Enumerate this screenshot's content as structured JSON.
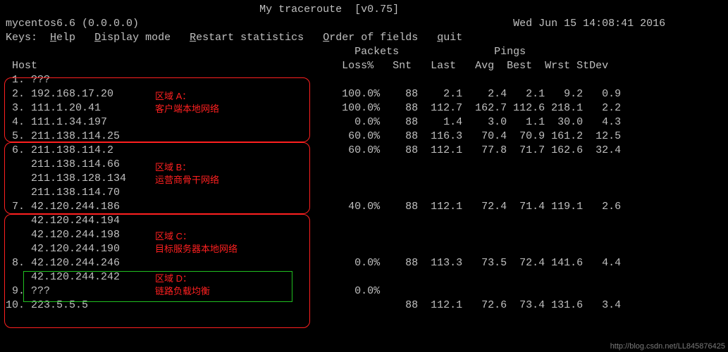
{
  "chart_data": {
    "type": "table",
    "columns": [
      "Hop",
      "Host",
      "Loss%",
      "Snt",
      "Last",
      "Avg",
      "Best",
      "Wrst",
      "StDev"
    ],
    "rows": [
      {
        "Hop": 1,
        "Host": "???",
        "Loss%": null,
        "Snt": null,
        "Last": null,
        "Avg": null,
        "Best": null,
        "Wrst": null,
        "StDev": null
      },
      {
        "Hop": 2,
        "Host": "192.168.17.20",
        "Loss%": 100.0,
        "Snt": 88,
        "Last": 2.1,
        "Avg": 2.4,
        "Best": 2.1,
        "Wrst": 9.2,
        "StDev": 0.9
      },
      {
        "Hop": 3,
        "Host": "111.1.20.41",
        "Loss%": 100.0,
        "Snt": 88,
        "Last": 112.7,
        "Avg": 162.7,
        "Best": 112.6,
        "Wrst": 218.1,
        "StDev": 2.2
      },
      {
        "Hop": 4,
        "Host": "111.1.34.197",
        "Loss%": 0.0,
        "Snt": 88,
        "Last": 1.4,
        "Avg": 3.0,
        "Best": 1.1,
        "Wrst": 30.0,
        "StDev": 4.3
      },
      {
        "Hop": 5,
        "Host": "211.138.114.25",
        "Loss%": 60.0,
        "Snt": 88,
        "Last": 116.3,
        "Avg": 70.4,
        "Best": 70.9,
        "Wrst": 161.2,
        "StDev": 12.5
      },
      {
        "Hop": 6,
        "Host": "211.138.114.2",
        "Loss%": 60.0,
        "Snt": 88,
        "Last": 112.1,
        "Avg": 77.8,
        "Best": 71.7,
        "Wrst": 162.6,
        "StDev": 32.4
      },
      {
        "Hop": 6,
        "Host": "211.138.114.66"
      },
      {
        "Hop": 6,
        "Host": "211.138.128.134"
      },
      {
        "Hop": 6,
        "Host": "211.138.114.70"
      },
      {
        "Hop": 7,
        "Host": "42.120.244.186",
        "Loss%": 40.0,
        "Snt": 88,
        "Last": 112.1,
        "Avg": 72.4,
        "Best": 71.4,
        "Wrst": 119.1,
        "StDev": 2.6
      },
      {
        "Hop": 7,
        "Host": "42.120.244.194"
      },
      {
        "Hop": 7,
        "Host": "42.120.244.198"
      },
      {
        "Hop": 7,
        "Host": "42.120.244.190"
      },
      {
        "Hop": 8,
        "Host": "42.120.244.246",
        "Loss%": 0.0,
        "Snt": 88,
        "Last": 113.3,
        "Avg": 73.5,
        "Best": 72.4,
        "Wrst": 141.6,
        "StDev": 4.4
      },
      {
        "Hop": 8,
        "Host": "42.120.244.242"
      },
      {
        "Hop": 9,
        "Host": "???",
        "Loss%": 0.0
      },
      {
        "Hop": 10,
        "Host": "223.5.5.5",
        "Snt": 88,
        "Last": 112.1,
        "Avg": 72.6,
        "Best": 73.4,
        "Wrst": 131.6,
        "StDev": 3.4
      }
    ]
  },
  "header": {
    "title": "My traceroute  [v0.75]",
    "hostline": "mycentos6.6 (0.0.0.0)",
    "date": "Wed Jun 15 14:08:41 2016"
  },
  "menu": {
    "keys": "Keys:",
    "help": {
      "u": "H",
      "rest": "elp"
    },
    "display": {
      "u": "D",
      "rest": "isplay mode"
    },
    "restart": {
      "u": "R",
      "rest": "estart statistics"
    },
    "order": {
      "u": "O",
      "rest": "rder of fields"
    },
    "quit": {
      "u": "q",
      "rest": "uit"
    }
  },
  "headers": {
    "packets": "Packets",
    "pings": "Pings",
    "host": "Host",
    "cols": "Loss%   Snt   Last   Avg  Best  Wrst StDev"
  },
  "rows": {
    "r1": " 1. ???",
    "r2": " 2. 192.168.17.20                                    100.0%    88    2.1    2.4   2.1   9.2   0.9",
    "r3": " 3. 111.1.20.41                                      100.0%    88  112.7  162.7 112.6 218.1   2.2",
    "r4": " 4. 111.1.34.197                                       0.0%    88    1.4    3.0   1.1  30.0   4.3",
    "r5": " 5. 211.138.114.25                                    60.0%    88  116.3   70.4  70.9 161.2  12.5",
    "r6": " 6. 211.138.114.2                                     60.0%    88  112.1   77.8  71.7 162.6  32.4",
    "r6a": "    211.138.114.66",
    "r6b": "    211.138.128.134",
    "r6c": "    211.138.114.70",
    "r7": " 7. 42.120.244.186                                    40.0%    88  112.1   72.4  71.4 119.1   2.6",
    "r7a": "    42.120.244.194",
    "r7b": "    42.120.244.198",
    "r7c": "    42.120.244.190",
    "r8": " 8. 42.120.244.246                                     0.0%    88  113.3   73.5  72.4 141.6   4.4",
    "r8a": "    42.120.244.242",
    "r9": " 9. ???                                                0.0%",
    "r10": "10. 223.5.5.5                                                  88  112.1   72.6  73.4 131.6   3.4"
  },
  "annotations": {
    "A": {
      "title": "区域 A：",
      "sub": "客户端本地网络"
    },
    "B": {
      "title": "区域 B：",
      "sub": "运营商骨干网络"
    },
    "C": {
      "title": "区域 C：",
      "sub": "目标服务器本地网络"
    },
    "D": {
      "title": "区域 D：",
      "sub": "链路负载均衡"
    }
  },
  "watermark": "http://blog.csdn.net/LL845876425"
}
